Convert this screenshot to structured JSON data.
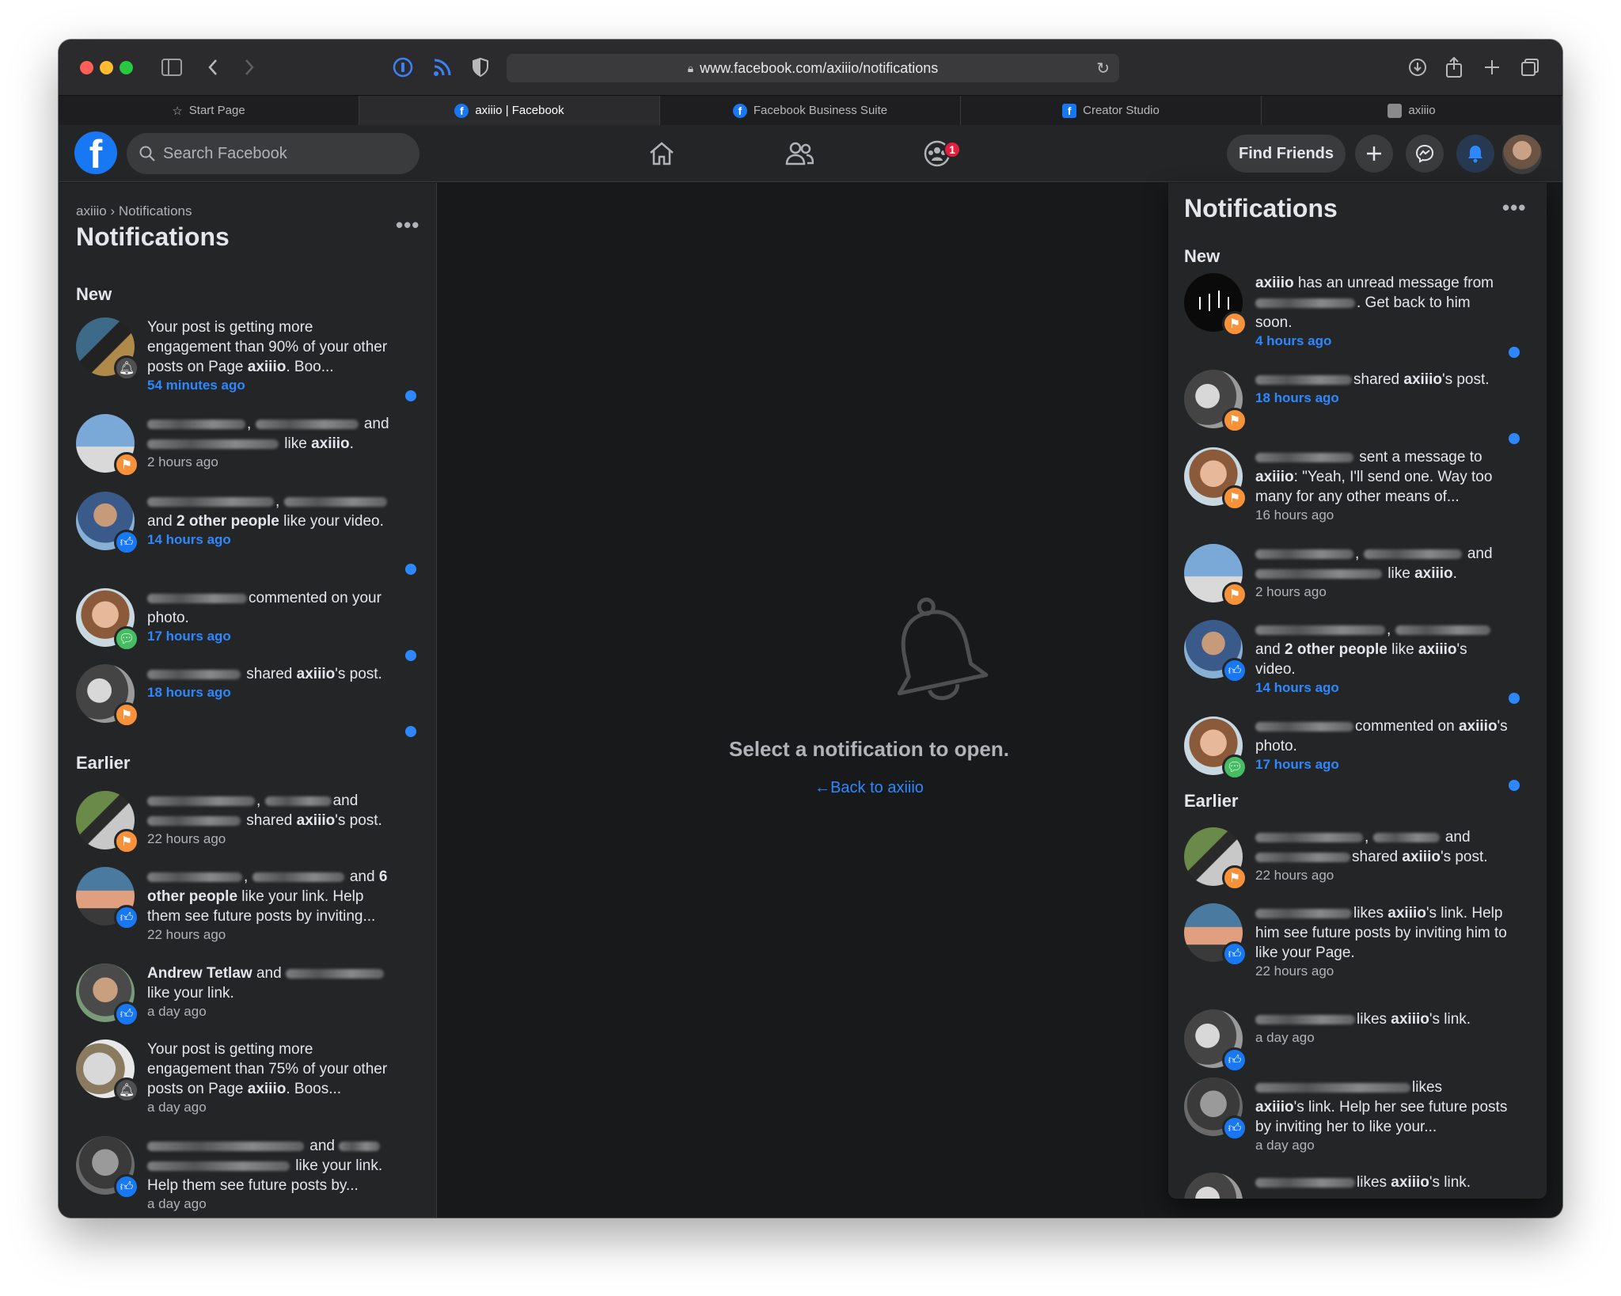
{
  "browser": {
    "url": "www.facebook.com/axiiio/notifications",
    "tabs": [
      {
        "label": "Start Page"
      },
      {
        "label": "axiiio | Facebook"
      },
      {
        "label": "Facebook Business Suite"
      },
      {
        "label": "Creator Studio"
      },
      {
        "label": "axiiio"
      }
    ]
  },
  "header": {
    "search_placeholder": "Search Facebook",
    "groups_badge": "1",
    "find_friends": "Find Friends"
  },
  "left": {
    "breadcrumb_parent": "axiiio",
    "breadcrumb_sep": "›",
    "breadcrumb_current": "Notifications",
    "title": "Notifications",
    "new_label": "New",
    "earlier_label": "Earlier",
    "items_new": [
      {
        "pre": "Your post is getting more engagement than 90% of your other posts on Page ",
        "bold": "axiiio",
        "post": ". Boo...",
        "time": "54 minutes ago"
      },
      {
        "pre": "and",
        "mid": "like ",
        "bold": "axiiio",
        "post": ".",
        "time": "2 hours ago"
      },
      {
        "pre": "and ",
        "bold": "2 other people",
        "post": " like your video.",
        "time": "14 hours ago"
      },
      {
        "pre": "commented on your photo.",
        "time": "17 hours ago"
      },
      {
        "pre": " shared ",
        "bold": "axiiio",
        "post": "'s post.",
        "time": "18 hours ago"
      }
    ],
    "items_earlier": [
      {
        "pre": "and",
        "mid": " shared ",
        "bold": "axiiio",
        "post": "'s post.",
        "time": "22 hours ago"
      },
      {
        "pre": "and ",
        "bold": "6 other people",
        "post": " like your link. Help them see future posts by inviting...",
        "time": "22 hours ago"
      },
      {
        "bold": "Andrew Tetlaw",
        "pre": " and",
        "post": "like your link.",
        "time": "a day ago"
      },
      {
        "pre": "Your post is getting more engagement than 75% of your other posts on Page ",
        "bold": "axiiio",
        "post": ". Boos...",
        "time": "a day ago"
      },
      {
        "pre": "and",
        "post": " like your link.",
        "post2": "Help them see future posts by...",
        "time": "a day ago"
      }
    ]
  },
  "center": {
    "message": "Select a notification to open.",
    "back": "Back to axiiio"
  },
  "right": {
    "title": "Notifications",
    "new_label": "New",
    "earlier_label": "Earlier",
    "items_new": [
      {
        "bold": "axiiio",
        "pre": " has an unread message from",
        "post": " Get back to him soon.",
        "time": "4 hours ago"
      },
      {
        "pre": "shared ",
        "bold": "axiiio",
        "post": "'s post.",
        "time": "18 hours ago"
      },
      {
        "pre": " sent a message to ",
        "bold": "axiiio",
        "post": ": \"Yeah, I'll send one. Way too many for any other means of...",
        "time": "16 hours ago"
      },
      {
        "pre": "and",
        "mid": "like ",
        "bold": "axiiio",
        "post": ".",
        "time": "2 hours ago"
      },
      {
        "pre": "and ",
        "bold": "2 other people",
        "mid": " like ",
        "bold2": "axiiio",
        "post": "'s video.",
        "time": "14 hours ago"
      },
      {
        "pre": "commented on ",
        "bold": "axiiio",
        "post": "'s photo.",
        "time": "17 hours ago"
      }
    ],
    "items_earlier": [
      {
        "pre": "and",
        "mid": "shared ",
        "bold": "axiiio",
        "post": "'s post.",
        "time": "22 hours ago"
      },
      {
        "pre": "likes ",
        "bold": "axiiio",
        "post": "'s link. Help him see future posts by inviting him to like your Page.",
        "time": "22 hours ago"
      },
      {
        "pre": "likes ",
        "bold": "axiiio",
        "post": "'s link.",
        "time": "a day ago"
      },
      {
        "pre": "likes",
        "bold": "axiiio",
        "post": "'s link. Help her see future posts by inviting her to like your...",
        "time": "a day ago"
      },
      {
        "pre": "likes ",
        "bold": "axiiio",
        "post": "'s link."
      }
    ]
  }
}
